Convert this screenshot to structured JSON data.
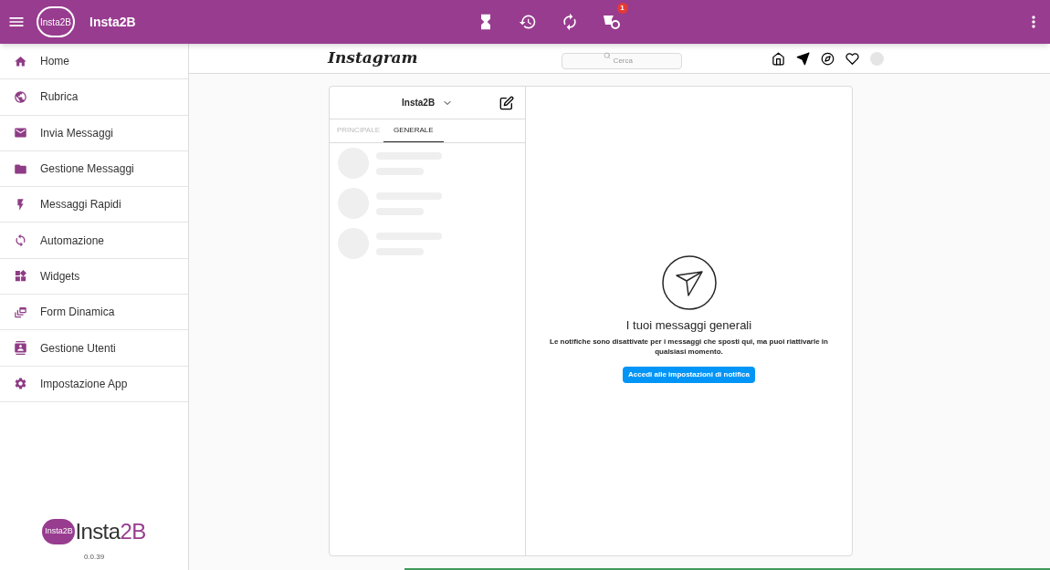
{
  "app_bar": {
    "logo_text": "Insta2B",
    "title": "Insta2B",
    "notification_badge": "1"
  },
  "sidebar": {
    "items": [
      {
        "label": "Home",
        "kind": "home"
      },
      {
        "label": "Rubrica",
        "kind": "contacts"
      },
      {
        "label": "Invia Messaggi",
        "kind": "mail"
      },
      {
        "label": "Gestione Messaggi",
        "kind": "folder"
      },
      {
        "label": "Messaggi Rapidi",
        "kind": "bolt"
      },
      {
        "label": "Automazione",
        "kind": "sync"
      },
      {
        "label": "Widgets",
        "kind": "widgets"
      },
      {
        "label": "Form Dinamica",
        "kind": "form"
      },
      {
        "label": "Gestione Utenti",
        "kind": "users"
      },
      {
        "label": "Impostazione App",
        "kind": "settings"
      }
    ],
    "footer": {
      "bubble_text": "Insta2B",
      "brand_text": "Insta",
      "brand_accent": "2B",
      "version": "0.0.39"
    }
  },
  "instagram": {
    "logo": "Instagram",
    "search_placeholder": "Cerca",
    "inbox": {
      "account": "Insta2B",
      "tabs": [
        {
          "label": "PRINCIPALE",
          "selected": false
        },
        {
          "label": "GENERALE",
          "selected": true
        }
      ]
    },
    "empty_state": {
      "title": "I tuoi messaggi generali",
      "text": "Le notifiche sono disattivate per i messaggi che sposti qui, ma puoi riattivarle in qualsiasi momento.",
      "button": "Accedi alle impostazioni di notifica"
    }
  }
}
